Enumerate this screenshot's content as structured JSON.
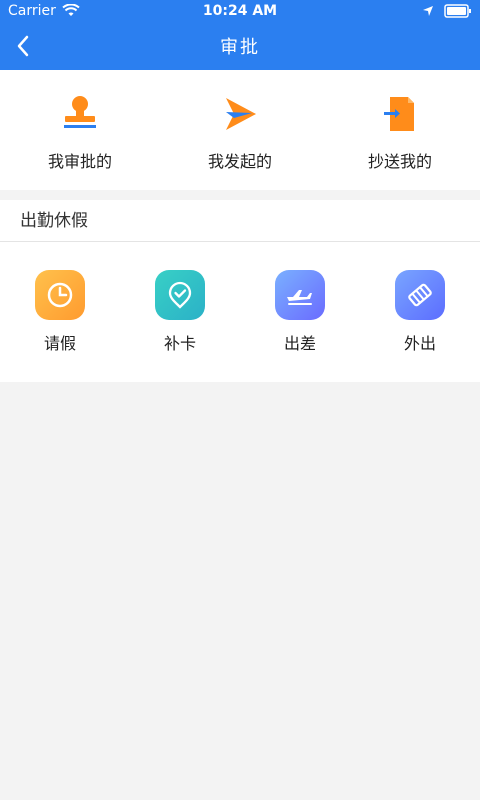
{
  "status": {
    "carrier": "Carrier",
    "time": "10:24 AM"
  },
  "nav": {
    "title": "审批"
  },
  "top": [
    {
      "label": "我审批的",
      "icon": "stamp-icon"
    },
    {
      "label": "我发起的",
      "icon": "send-icon"
    },
    {
      "label": "抄送我的",
      "icon": "cc-document-icon"
    }
  ],
  "section": {
    "title": "出勤休假",
    "items": [
      {
        "label": "请假",
        "icon": "clock-icon"
      },
      {
        "label": "补卡",
        "icon": "location-check-icon"
      },
      {
        "label": "出差",
        "icon": "airplane-icon"
      },
      {
        "label": "外出",
        "icon": "outing-icon"
      }
    ]
  },
  "colors": {
    "brand": "#2b7ff0",
    "background": "#f3f3f3"
  }
}
